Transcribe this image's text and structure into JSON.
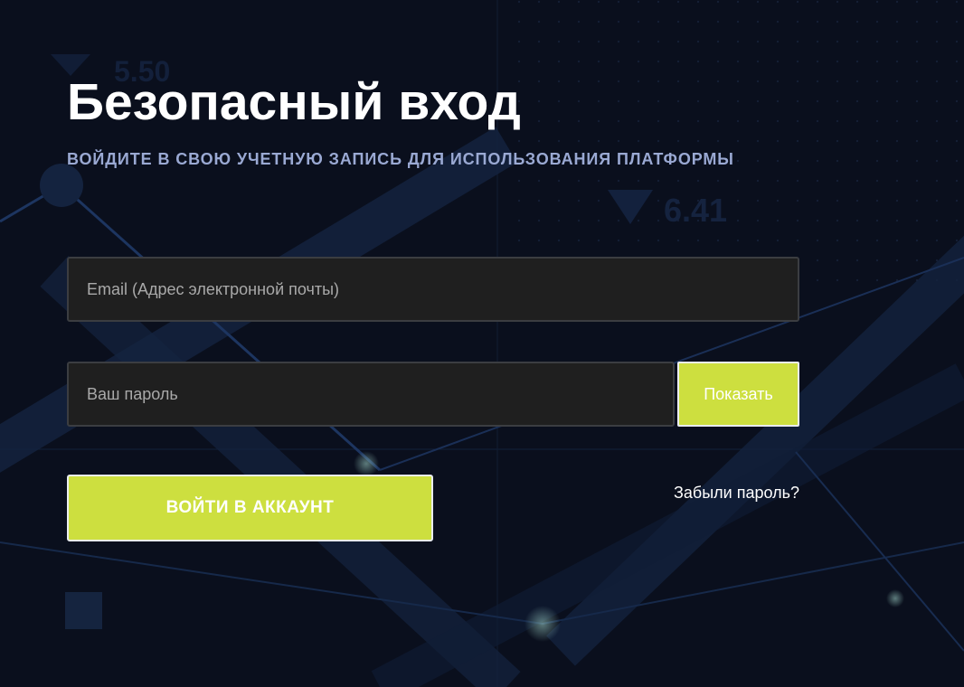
{
  "page": {
    "title": "Безопасный вход",
    "subtitle": "ВОЙДИТЕ В СВОЮ УЧЕТНУЮ ЗАПИСЬ ДЛЯ ИСПОЛЬЗОВАНИЯ ПЛАТФОРМЫ"
  },
  "form": {
    "email": {
      "placeholder": "Email (Адрес электронной почты)",
      "value": ""
    },
    "password": {
      "placeholder": "Ваш пароль",
      "value": ""
    },
    "show_password_label": "Показать",
    "login_label": "ВОЙТИ В АККАУНТ",
    "forgot_label": "Забыли пароль?"
  },
  "background": {
    "ticker_values": [
      "5.50",
      "6.41"
    ]
  },
  "colors": {
    "background": "#0a0f1d",
    "accent": "#cddf3f",
    "subtitle": "#9aa9d3",
    "input_background": "#1f1f1f",
    "input_border": "#3b3d41",
    "text": "#ffffff"
  }
}
